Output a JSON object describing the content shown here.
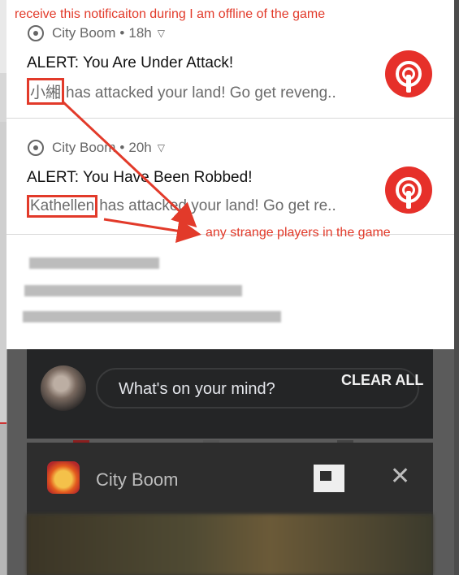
{
  "annotations": {
    "top": "receive this notificaiton during I am offline of the game",
    "middle": "any strange players in the game"
  },
  "notifications": [
    {
      "app": "City Boom",
      "time": "18h",
      "title": "ALERT: You Are Under Attack!",
      "attacker": "小緗",
      "message": "has attacked your land! Go get reveng.."
    },
    {
      "app": "City Boom",
      "time": "20h",
      "title": "ALERT: You Have Been Robbed!",
      "attacker": "Kathellen",
      "message": "has attacked your land! Go get re.."
    }
  ],
  "background_feed": {
    "composer_placeholder": "What's on your mind?"
  },
  "shade_actions": {
    "clear_all": "CLEAR ALL"
  },
  "recent_app": {
    "name": "City Boom"
  },
  "icons": {
    "app_small": "broadcast-icon",
    "app_large": "city-boom-red-icon",
    "expand": "chevron-down-icon",
    "split": "split-screen-icon",
    "close": "close-icon"
  },
  "colors": {
    "annotation_red": "#e23a2a",
    "icon_red": "#e6302a"
  }
}
